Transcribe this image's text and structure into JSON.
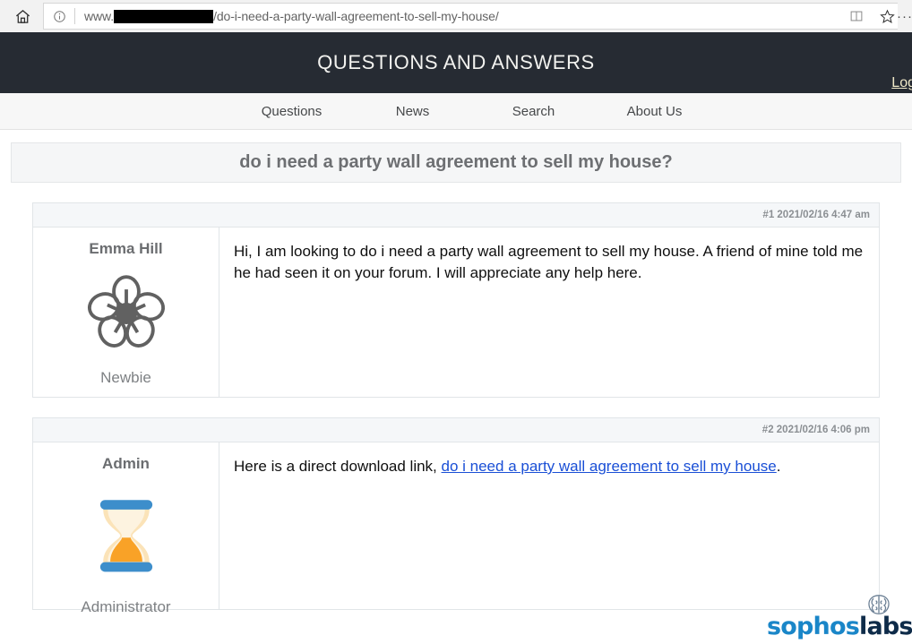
{
  "browser": {
    "home_icon": "home-icon",
    "info_icon": "info-circle-icon",
    "url_prefix": "www.",
    "url_redacted": "",
    "url_suffix": "/do-i-need-a-party-wall-agreement-to-sell-my-house/",
    "reading_view_icon": "book-icon",
    "favorite_icon": "star-icon",
    "more_menu_icon": "ellipsis-icon",
    "more_menu_glyph": "···"
  },
  "site": {
    "title": "QUESTIONS AND ANSWERS",
    "login_label": "Log",
    "header_bg": "#262b33",
    "nav": [
      {
        "label": "Questions"
      },
      {
        "label": "News"
      },
      {
        "label": "Search"
      },
      {
        "label": "About Us"
      }
    ]
  },
  "thread": {
    "title": "do i need a party wall agreement to sell my house?",
    "posts": [
      {
        "meta": "#1 2021/02/16 4:47 am",
        "author": "Emma Hill",
        "rank": "Newbie",
        "avatar_icon": "flower-avatar-icon",
        "body_text": "Hi, I am looking to do i need a party wall agreement to sell my house. A friend of mine told me he had seen it on your forum. I will appreciate any help here.",
        "link_text": "",
        "body_prefix": "",
        "body_suffix": ""
      },
      {
        "meta": "#2 2021/02/16 4:06 pm",
        "author": "Admin",
        "rank": "Administrator",
        "avatar_icon": "hourglass-avatar-icon",
        "body_text": "",
        "body_prefix": "Here is a direct download link, ",
        "link_text": "do i need a party wall agreement to sell my house",
        "body_suffix": "."
      }
    ]
  },
  "watermark": {
    "brand_part1": "sophos",
    "brand_part2": "labs",
    "icon": "brain-icon",
    "color_part1": "#1a86c8",
    "color_part2": "#0e2b49"
  }
}
